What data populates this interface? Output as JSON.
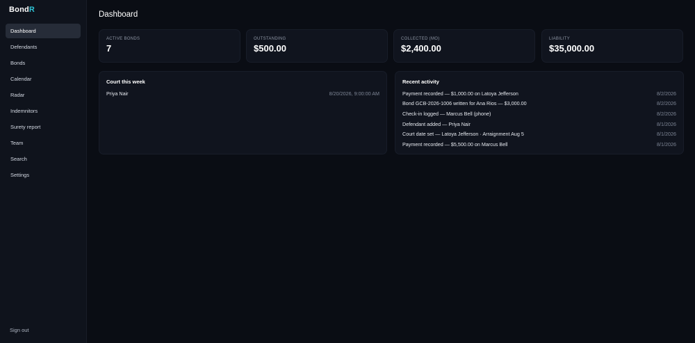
{
  "brand": {
    "name_main": "Bond",
    "name_accent": "R",
    "accent_color": "#2ec4d6"
  },
  "sidebar": {
    "items": [
      {
        "label": "Dashboard",
        "active": true
      },
      {
        "label": "Defendants"
      },
      {
        "label": "Bonds"
      },
      {
        "label": "Calendar"
      },
      {
        "label": "Radar"
      },
      {
        "label": "Indemnitors"
      },
      {
        "label": "Surety report"
      },
      {
        "label": "Team"
      },
      {
        "label": "Search"
      },
      {
        "label": "Settings"
      }
    ],
    "sign_out": "Sign out"
  },
  "header": {
    "title": "Dashboard"
  },
  "stats": [
    {
      "label": "ACTIVE BONDS",
      "value": "7"
    },
    {
      "label": "OUTSTANDING",
      "value": "$500.00"
    },
    {
      "label": "COLLECTED (MO)",
      "value": "$2,400.00"
    },
    {
      "label": "LIABILITY",
      "value": "$35,000.00"
    }
  ],
  "court": {
    "title": "Court this week",
    "rows": [
      {
        "name": "Priya Nair",
        "when": "8/20/2026, 9:00:00 AM"
      }
    ]
  },
  "activity": {
    "title": "Recent activity",
    "rows": [
      {
        "text": "Payment recorded — $1,000.00 on Latoya Jefferson",
        "date": "8/2/2026"
      },
      {
        "text": "Bond GCB-2026-1006 written for Ana Rios — $3,000.00",
        "date": "8/2/2026"
      },
      {
        "text": "Check-in logged — Marcus Bell (phone)",
        "date": "8/2/2026"
      },
      {
        "text": "Defendant added — Priya Nair",
        "date": "8/1/2026"
      },
      {
        "text": "Court date set — Latoya Jefferson · Arraignment Aug 5",
        "date": "8/1/2026"
      },
      {
        "text": "Payment recorded — $5,500.00 on Marcus Bell",
        "date": "8/1/2026"
      }
    ]
  }
}
